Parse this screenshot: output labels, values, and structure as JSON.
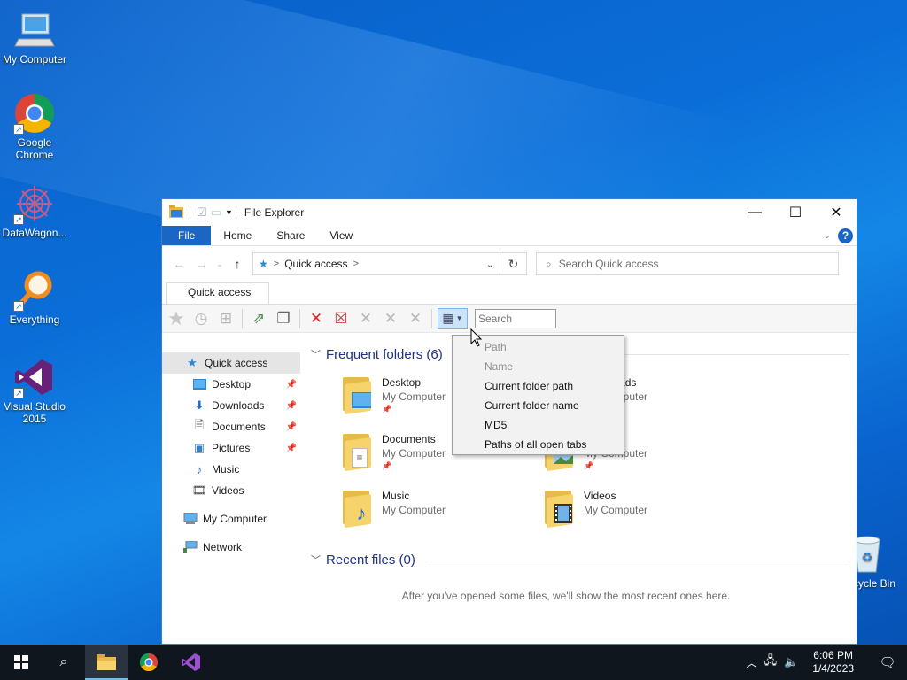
{
  "desktop": {
    "icons": [
      {
        "label": "My Computer"
      },
      {
        "label": "Google Chrome"
      },
      {
        "label": "DataWagon..."
      },
      {
        "label": "Everything"
      },
      {
        "label": "Visual Studio 2015"
      },
      {
        "label": "cycle Bin"
      }
    ]
  },
  "window": {
    "title": "File Explorer",
    "ribbon_tabs": [
      "File",
      "Home",
      "Share",
      "View"
    ],
    "help_label": "?",
    "address": {
      "location": "Quick access",
      "separator": ">"
    },
    "search_placeholder": "Search Quick access",
    "tab_label": "Quick access",
    "toolbar_search_placeholder": "Search",
    "nav": [
      {
        "label": "Quick access",
        "icon": "star-icon"
      },
      {
        "label": "Desktop",
        "icon": "desktop-icon",
        "pinned": true
      },
      {
        "label": "Downloads",
        "icon": "download-icon",
        "pinned": true
      },
      {
        "label": "Documents",
        "icon": "document-icon",
        "pinned": true
      },
      {
        "label": "Pictures",
        "icon": "picture-icon",
        "pinned": true
      },
      {
        "label": "Music",
        "icon": "music-icon"
      },
      {
        "label": "Videos",
        "icon": "video-icon"
      },
      {
        "label": "My Computer",
        "icon": "computer-icon"
      },
      {
        "label": "Network",
        "icon": "network-icon"
      }
    ],
    "frequent_header": "Frequent folders (6)",
    "folders": [
      {
        "name": "Desktop",
        "location": "My Computer"
      },
      {
        "name": "Downloads",
        "location": "My Computer"
      },
      {
        "name": "Documents",
        "location": "My Computer"
      },
      {
        "name": "Pictures",
        "location": "My Computer"
      },
      {
        "name": "Music",
        "location": "My Computer"
      },
      {
        "name": "Videos",
        "location": "My Computer"
      }
    ],
    "recent_header": "Recent files (0)",
    "recent_empty": "After you've opened some files, we'll show the most recent ones here."
  },
  "menu": {
    "items": [
      {
        "label": "Path",
        "enabled": false
      },
      {
        "label": "Name",
        "enabled": false
      },
      {
        "label": "Current folder path",
        "enabled": true
      },
      {
        "label": "Current folder name",
        "enabled": true
      },
      {
        "label": "MD5",
        "enabled": true
      },
      {
        "label": "Paths of all open tabs",
        "enabled": true
      }
    ]
  },
  "taskbar": {
    "time": "6:06 PM",
    "date": "1/4/2023"
  },
  "colors": {
    "accent": "#1a66c2",
    "taskbar": "#10161e",
    "group_header": "#1e3287"
  }
}
